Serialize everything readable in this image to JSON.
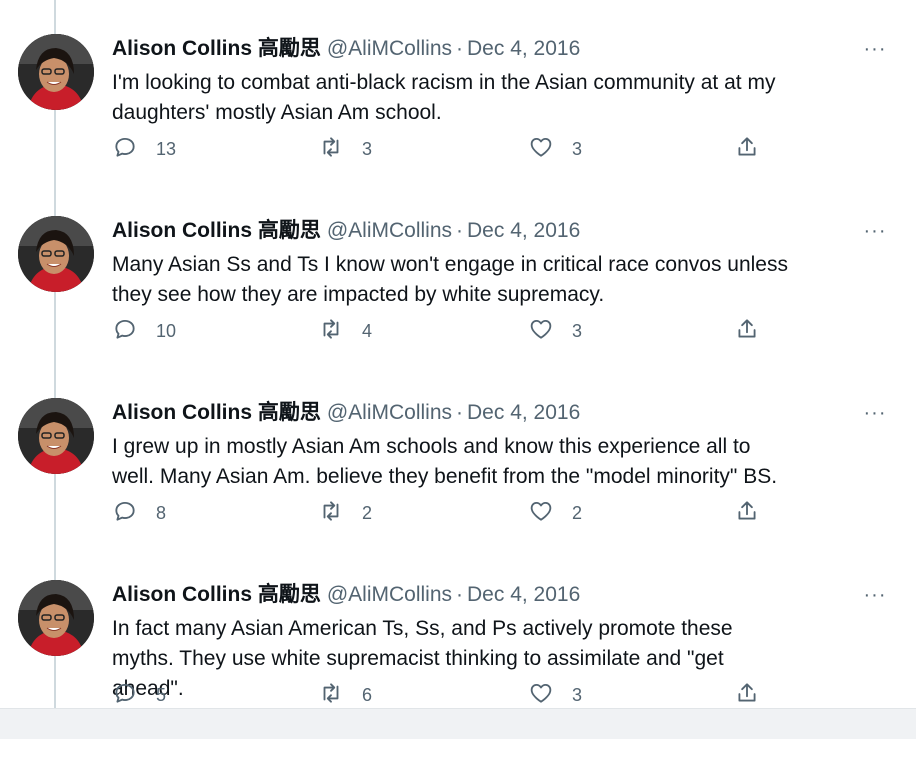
{
  "author": {
    "name": "Alison Collins 高勵思",
    "handle": "@AliMCollins",
    "separator": "·"
  },
  "more_label": "···",
  "tweets": [
    {
      "date": "Dec 4, 2016",
      "text": "I'm looking to combat anti-black racism in the Asian community at at my\ndaughters' mostly Asian Am school.",
      "replies": "13",
      "retweets": "3",
      "likes": "3"
    },
    {
      "date": "Dec 4, 2016",
      "text": "Many Asian Ss and Ts I know won't engage in critical race convos unless\nthey see how they are impacted by white supremacy.",
      "replies": "10",
      "retweets": "4",
      "likes": "3"
    },
    {
      "date": "Dec 4, 2016",
      "text": "I grew up in mostly Asian Am schools and know this experience all to\nwell. Many Asian Am. believe they benefit from the \"model minority\" BS.",
      "replies": "8",
      "retweets": "2",
      "likes": "2"
    },
    {
      "date": "Dec 4, 2016",
      "text": "In fact many Asian American Ts, Ss, and Ps actively promote these\nmyths. They use white supremacist thinking to assimilate and \"get\nahead\".",
      "replies": "5",
      "retweets": "6",
      "likes": "3"
    }
  ],
  "icons": {
    "reply": "reply-icon",
    "retweet": "retweet-icon",
    "like": "like-icon",
    "share": "share-icon"
  },
  "colors": {
    "text": "#0f1419",
    "secondary": "#536471",
    "thread_line": "#cfd9de"
  }
}
